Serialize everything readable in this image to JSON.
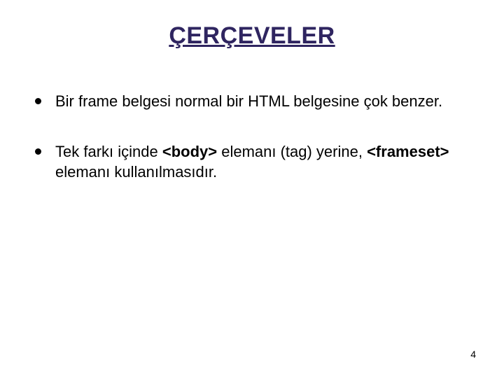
{
  "title": "ÇERÇEVELER",
  "bullets": [
    {
      "pre": "Bir frame belgesi normal bir HTML belgesine çok benzer."
    },
    {
      "pre": "Tek farkı içinde ",
      "bold1": "<body>",
      "mid": " elemanı (tag) yerine, ",
      "bold2": "<frameset>",
      "post": " elemanı kullanılmasıdır."
    }
  ],
  "pageNumber": "4"
}
